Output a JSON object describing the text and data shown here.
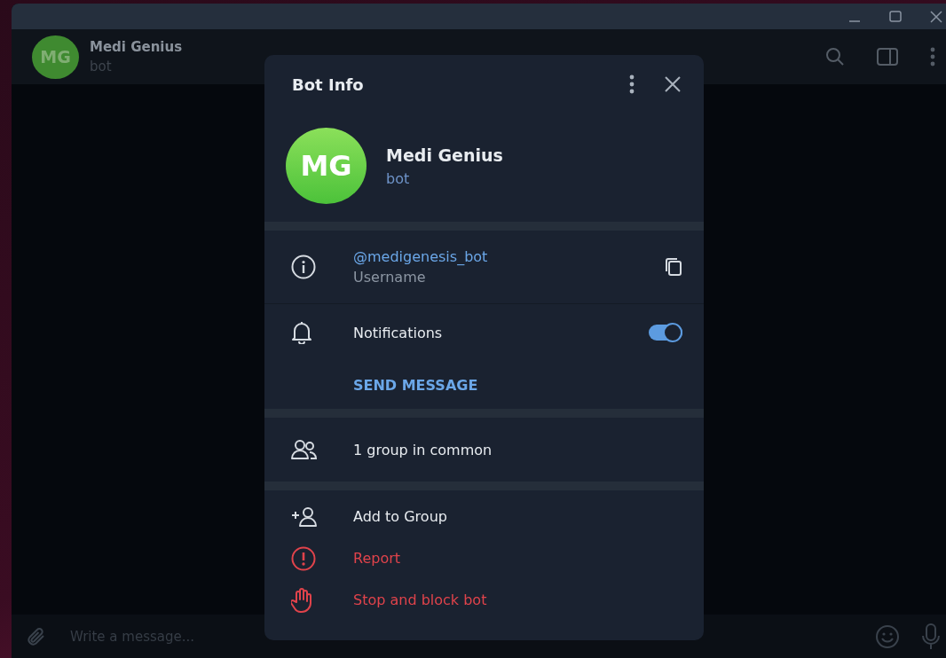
{
  "chat_header": {
    "initials": "MG",
    "name": "Medi Genius",
    "status": "bot"
  },
  "composer": {
    "placeholder": "Write a message..."
  },
  "dialog": {
    "title": "Bot Info",
    "profile": {
      "initials": "MG",
      "name": "Medi Genius",
      "status": "bot"
    },
    "username": {
      "value": "@medigenesis_bot",
      "label": "Username"
    },
    "notifications": {
      "label": "Notifications",
      "on": true
    },
    "send_message": "SEND MESSAGE",
    "groups_in_common": "1 group in common",
    "actions": [
      {
        "label": "Add to Group",
        "kind": "add"
      },
      {
        "label": "Report",
        "kind": "report"
      },
      {
        "label": "Stop and block bot",
        "kind": "block"
      }
    ]
  }
}
